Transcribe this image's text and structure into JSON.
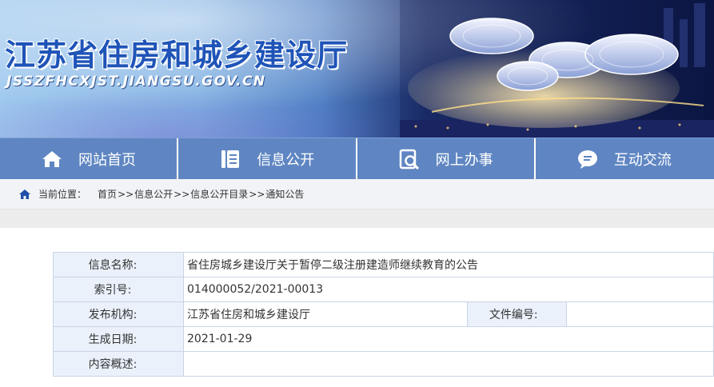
{
  "banner": {
    "title": "江苏省住房和城乡建设厅",
    "url": "JSSZFHCXJST.JIANGSU.GOV.CN"
  },
  "nav": {
    "items": [
      {
        "label": "网站首页",
        "icon": "home-icon"
      },
      {
        "label": "信息公开",
        "icon": "document-list-icon"
      },
      {
        "label": "网上办事",
        "icon": "search-document-icon"
      },
      {
        "label": "互动交流",
        "icon": "chat-bubble-icon"
      }
    ]
  },
  "breadcrumb": {
    "lead": "当前位置：",
    "items": [
      "首页",
      "信息公开",
      "信息公开目录",
      "通知公告"
    ],
    "separator": ">>"
  },
  "info": {
    "name_label": "信息名称:",
    "name_value": "省住房城乡建设厅关于暂停二级注册建造师继续教育的公告",
    "index_label": "索引号:",
    "index_value": "014000052/2021-00013",
    "org_label": "发布机构:",
    "org_value": "江苏省住房和城乡建设厅",
    "docno_label": "文件编号:",
    "docno_value": "",
    "date_label": "生成日期:",
    "date_value": "2021-01-29",
    "summary_label": "内容概述:",
    "summary_value": ""
  },
  "colors": {
    "nav_bg": "#5f86c2",
    "title_blue": "#1f54b8",
    "label_bg": "#eaf1fb"
  }
}
